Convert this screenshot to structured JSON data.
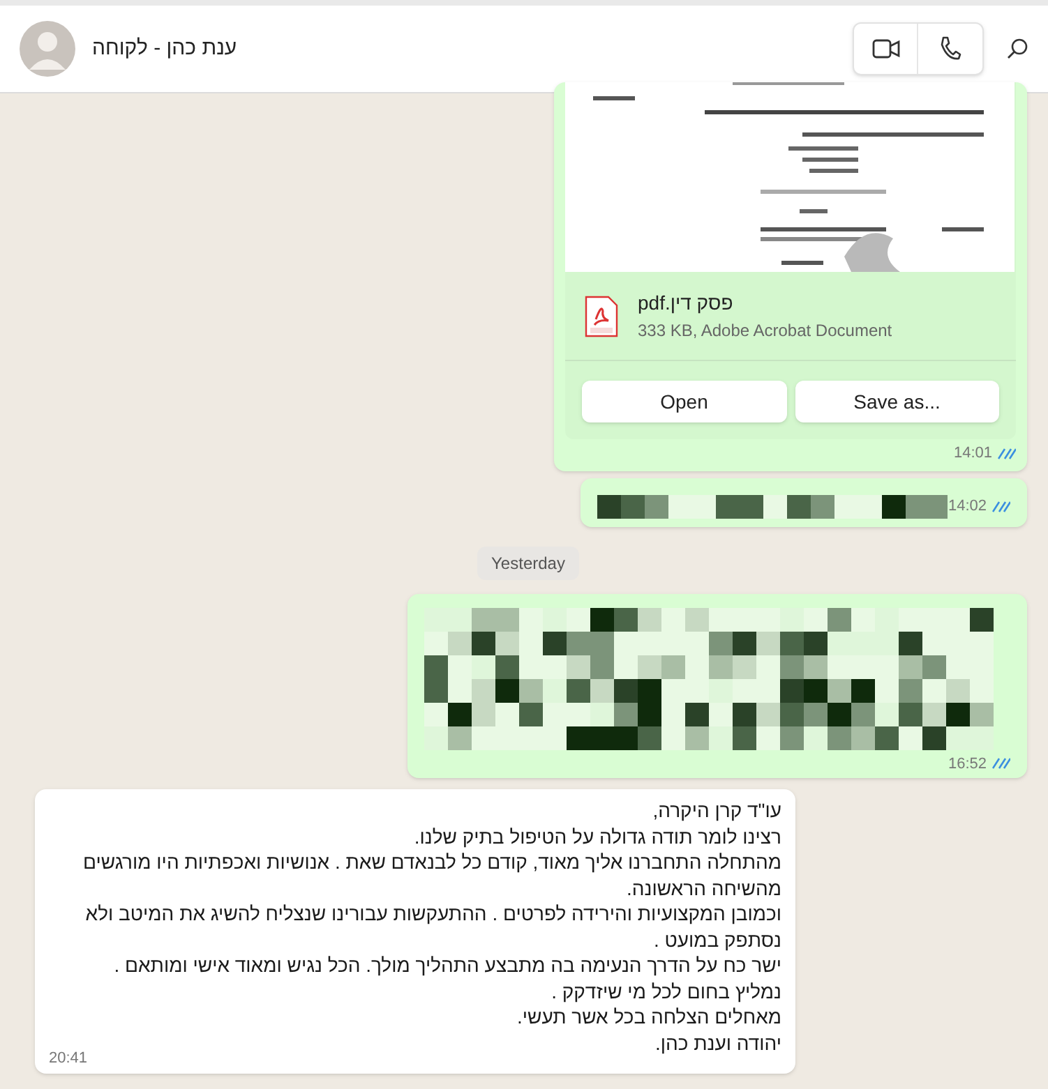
{
  "header": {
    "title": "ענת כהן - לקוחה"
  },
  "messages": [
    {
      "kind": "document",
      "outgoing": true,
      "file_name": "פסק דין.pdf",
      "file_info": "333 KB, Adobe Acrobat Document",
      "open_button": "Open",
      "save_button": "Save as...",
      "time": "14:01",
      "read": true
    },
    {
      "kind": "hidden",
      "outgoing": true,
      "time": "14:02",
      "read": true
    },
    {
      "kind": "divider",
      "label": "Yesterday"
    },
    {
      "kind": "hidden",
      "outgoing": true,
      "time": "16:52",
      "read": true
    },
    {
      "kind": "text",
      "outgoing": false,
      "lines": [
        "עו\"ד קרן היקרה,",
        "רצינו לומר תודה גדולה על הטיפול בתיק שלנו.",
        "מהתחלה התחברנו אליך מאוד, קודם כל לבנאדם שאת . אנושיות ואכפתיות היו מורגשים",
        "מהשיחה הראשונה.",
        "וכמובן המקצועיות והירידה לפרטים . ההתעקשות עבורינו שנצליח להשיג את המיטב ולא",
        "נסתפק במועט .",
        "ישר כח על הדרך הנעימה בה מתבצע התהליך מולך. הכל נגיש ומאוד אישי ומותאם .",
        "נמליץ בחום לכל מי שיזדקק .",
        "מאחלים הצלחה בכל אשר תעשי.",
        "יהודה וענת כהן."
      ],
      "time": "20:41"
    }
  ]
}
